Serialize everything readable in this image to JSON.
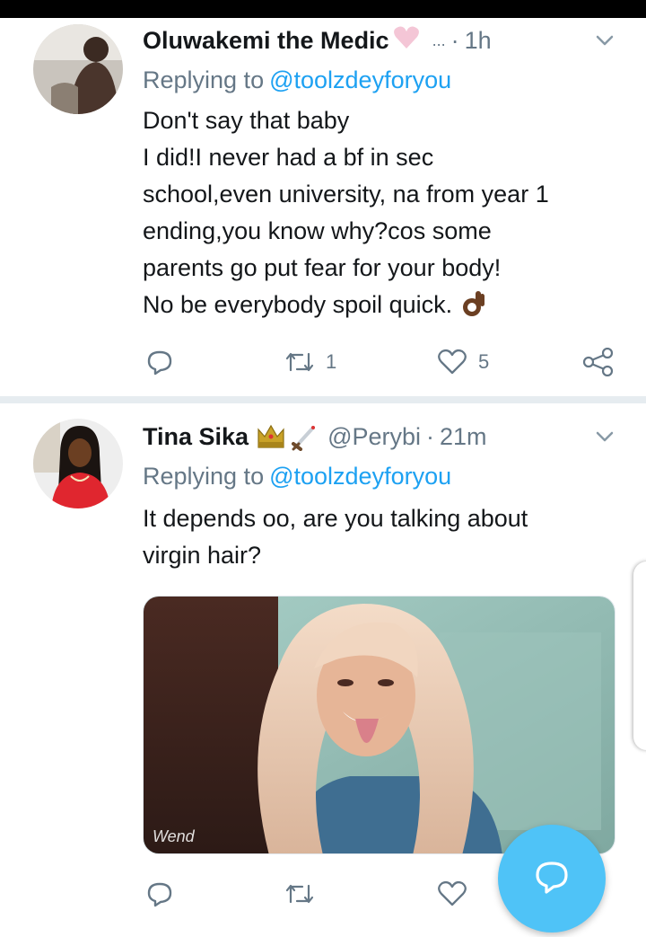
{
  "tweets": [
    {
      "display_name": "Oluwakemi the Medic",
      "emoji_after_name": "heart-emoji",
      "handle": "...",
      "separator": "·",
      "time": "1h",
      "replying_prefix": "Replying to",
      "replying_to": "@toolzdeyforyou",
      "text_lines": [
        "Don't say that baby",
        "I did!I never had a bf in sec",
        "school,even university, na from year 1",
        "ending,you know why?cos some",
        "parents go put fear for your body!",
        "No be everybody spoil quick."
      ],
      "text_end_emoji": "ok-hand-emoji",
      "retweet_count": "1",
      "like_count": "5"
    },
    {
      "display_name": "Tina Sika",
      "emoji_after_name": "crown-dagger-emoji",
      "handle": "@Perybi",
      "separator": "·",
      "time": "21m",
      "replying_prefix": "Replying to",
      "replying_to": "@toolzdeyforyou",
      "text_lines": [
        "It depends oo, are you talking about",
        "virgin hair?"
      ],
      "media_watermark": "Wend",
      "retweet_count": "",
      "like_count": ""
    }
  ],
  "icons": {
    "reply": "reply-icon",
    "retweet": "retweet-icon",
    "like": "heart-icon",
    "share": "share-icon",
    "caret": "chevron-down-icon",
    "compose": "compose-reply-icon"
  },
  "colors": {
    "text": "#14171a",
    "muted": "#657786",
    "link": "#1da1f2",
    "fab": "#4fc3f7",
    "divider": "#e6ecf0"
  }
}
